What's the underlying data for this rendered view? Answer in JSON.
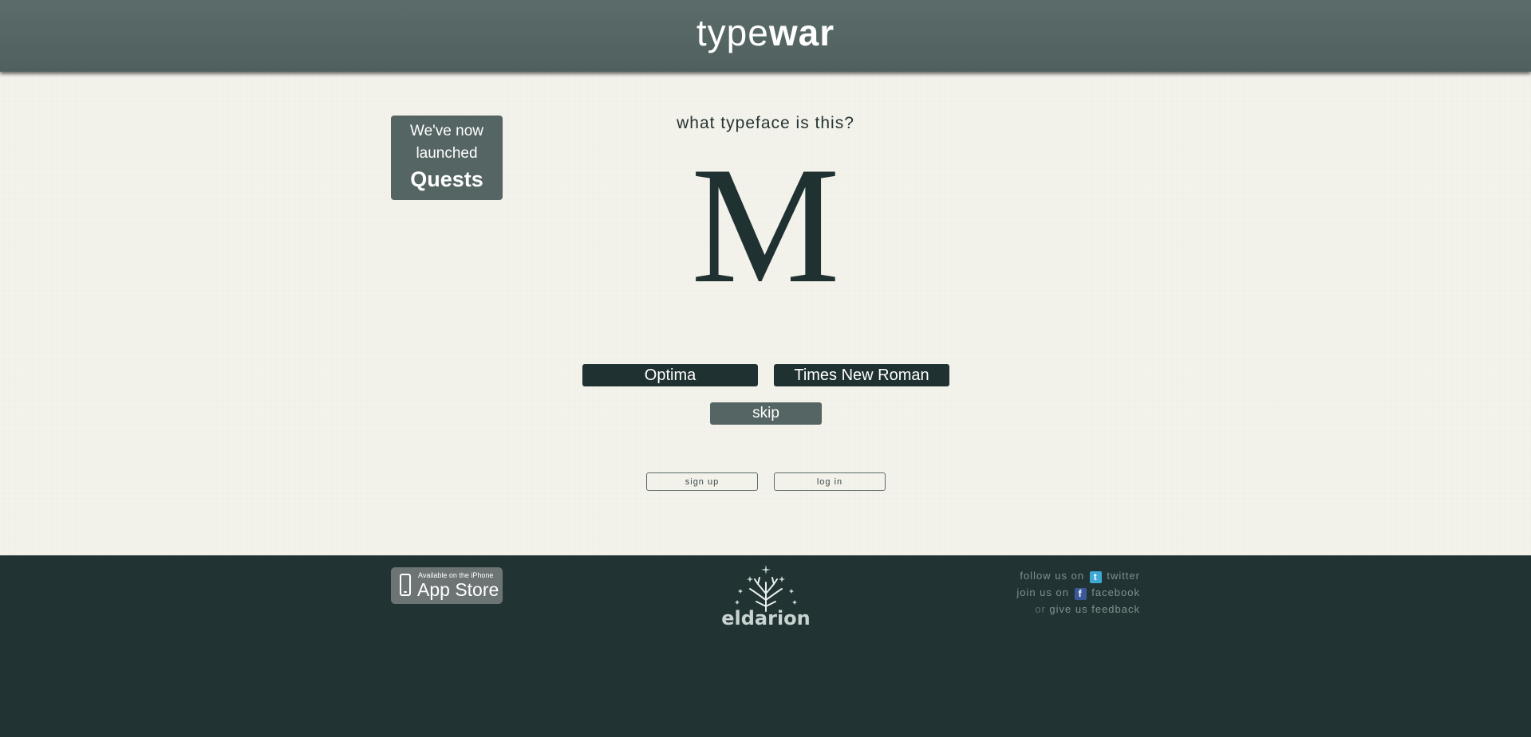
{
  "header": {
    "logo_light": "type",
    "logo_bold": "war"
  },
  "promo": {
    "line1": "We've now",
    "line2": "launched",
    "line3": "Quests"
  },
  "quiz": {
    "question": "what typeface is this?",
    "specimen": "M",
    "choices": [
      "Optima",
      "Times New Roman"
    ],
    "skip_label": "skip"
  },
  "auth": {
    "signup_label": "sign up",
    "login_label": "log in"
  },
  "footer": {
    "appstore_small": "Available on the iPhone",
    "appstore_big": "App Store",
    "brand": "eldarion",
    "social": {
      "follow_prefix": "follow us on",
      "twitter": "twitter",
      "join_prefix": "join us on",
      "facebook": "facebook",
      "or_text": "or",
      "feedback": "give us feedback"
    }
  },
  "colors": {
    "header_bg": "#556665",
    "page_bg": "#f4f3ec",
    "dark": "#1f3130",
    "slate": "#556564",
    "footer_bg": "#213332",
    "social_text": "#7f9290"
  },
  "icons": {
    "twitter": "twitter-icon",
    "facebook": "facebook-icon",
    "phone": "phone-icon"
  }
}
